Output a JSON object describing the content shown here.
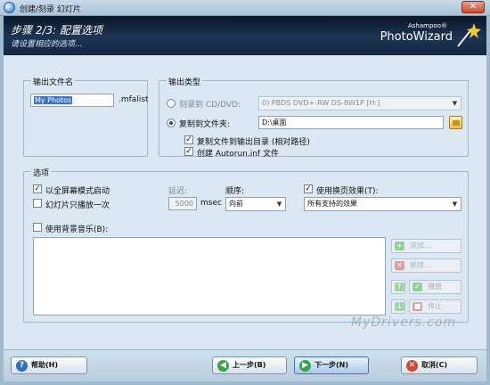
{
  "window": {
    "title": "创建/刻录 幻灯片",
    "close_glyph": "✕"
  },
  "header": {
    "step_title": "步骤 2/3: 配置选项",
    "step_subtitle": "请设置相应的选项...",
    "brand_small": "Ashampoo®",
    "brand_big": "PhotoWizard"
  },
  "output_name": {
    "title": "输出文件名",
    "value": "My Photos",
    "extension": ".mfalist"
  },
  "output_type": {
    "title": "输出类型",
    "burn_label": "刻录到 CD/DVD:",
    "drive_value": "0) PBDS DVD+-RW DS-8W1P [H:]",
    "copy_label": "复制到文件夹:",
    "folder_value": "D:\\桌面",
    "copy_to_output_label": "复制文件到输出目录 (相对路径)",
    "create_autorun_label": "创建 Autorun.inf 文件",
    "selected": "copy"
  },
  "options": {
    "title": "选项",
    "fullscreen_label": "以全屏幕模式启动",
    "fullscreen_checked": true,
    "play_once_label": "幻灯片只播放一次",
    "play_once_checked": false,
    "delay_label": "延迟:",
    "delay_value": "5000",
    "delay_unit": "msec",
    "order_label": "顺序:",
    "order_value": "向前",
    "transition_label": "使用换页效果(T):",
    "transition_checked": true,
    "transition_value": "所有支持的效果",
    "music_label": "使用背景音乐(B):",
    "music_checked": false,
    "side_buttons": {
      "add": "添加...",
      "remove": "移除...",
      "play": "播放",
      "stop": "停止"
    }
  },
  "footer": {
    "help": "帮助(H)",
    "back": "上一步(B)",
    "next": "下一步(N)",
    "cancel": "取消(C)"
  },
  "watermark": "MyDrivers.com",
  "colors": {
    "header_bg": "#132640",
    "panel_bg": "#dbe7f3",
    "accent": "#3a73c8"
  }
}
